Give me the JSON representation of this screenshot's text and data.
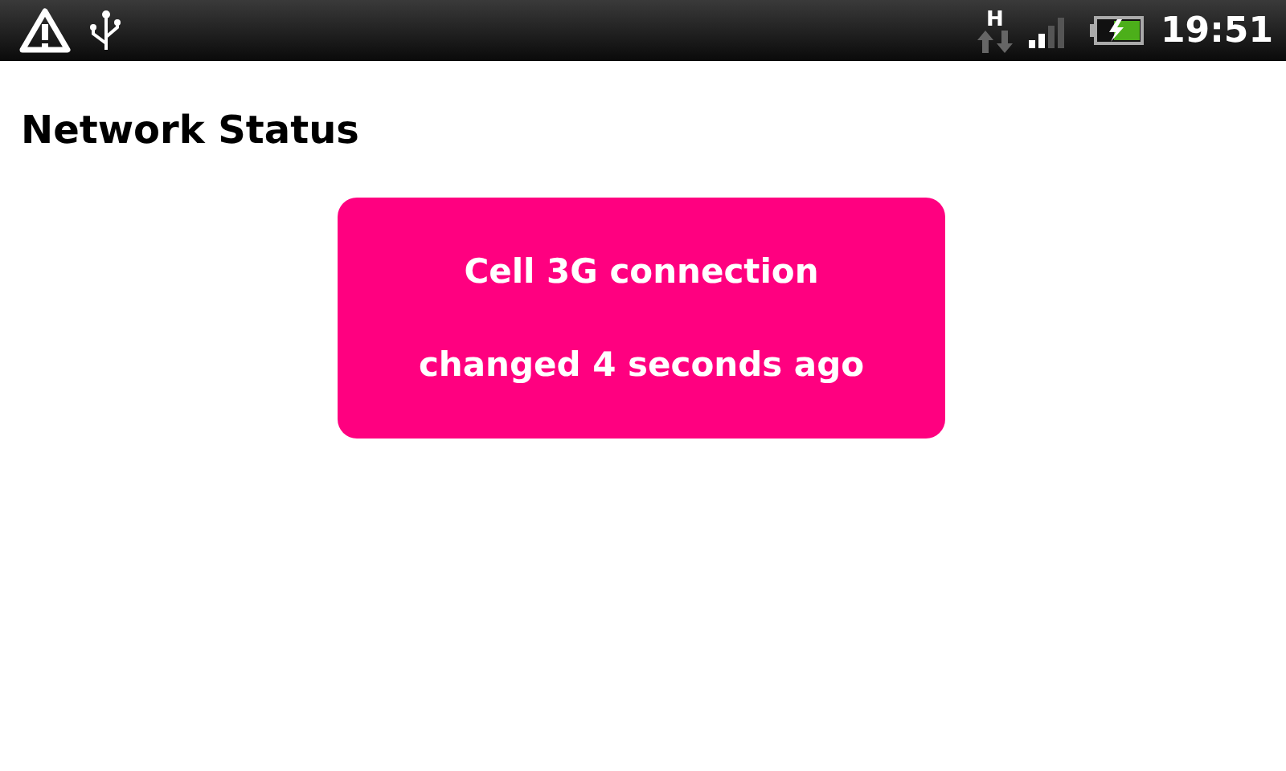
{
  "status_bar": {
    "network_type": "H",
    "time": "19:51"
  },
  "title": "Network Status",
  "card": {
    "color": "#ff0080",
    "lines": [
      "Cell 3G connection",
      "changed 4 seconds ago"
    ]
  }
}
